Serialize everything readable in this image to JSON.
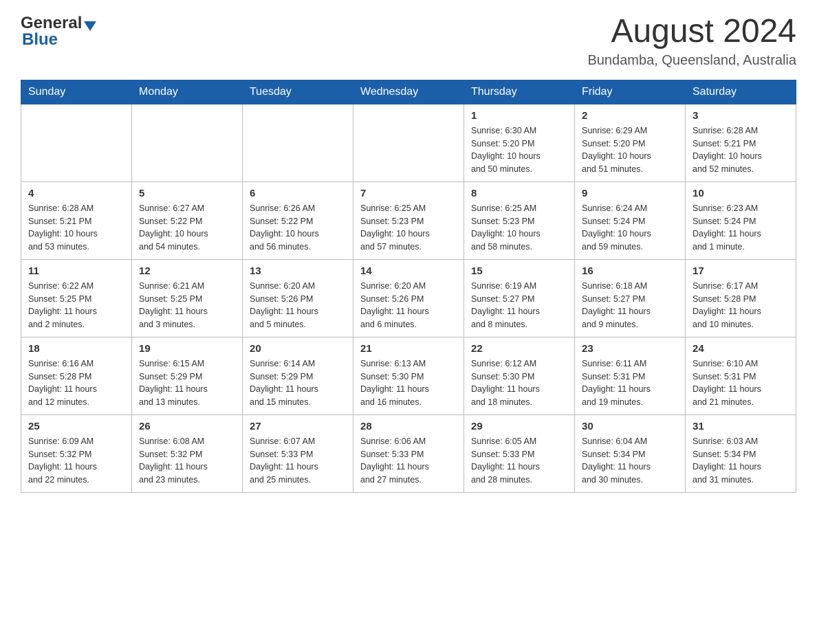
{
  "header": {
    "logo_general": "General",
    "logo_blue": "Blue",
    "month_title": "August 2024",
    "location": "Bundamba, Queensland, Australia"
  },
  "calendar": {
    "days_of_week": [
      "Sunday",
      "Monday",
      "Tuesday",
      "Wednesday",
      "Thursday",
      "Friday",
      "Saturday"
    ],
    "weeks": [
      [
        {
          "day": "",
          "info": ""
        },
        {
          "day": "",
          "info": ""
        },
        {
          "day": "",
          "info": ""
        },
        {
          "day": "",
          "info": ""
        },
        {
          "day": "1",
          "info": "Sunrise: 6:30 AM\nSunset: 5:20 PM\nDaylight: 10 hours\nand 50 minutes."
        },
        {
          "day": "2",
          "info": "Sunrise: 6:29 AM\nSunset: 5:20 PM\nDaylight: 10 hours\nand 51 minutes."
        },
        {
          "day": "3",
          "info": "Sunrise: 6:28 AM\nSunset: 5:21 PM\nDaylight: 10 hours\nand 52 minutes."
        }
      ],
      [
        {
          "day": "4",
          "info": "Sunrise: 6:28 AM\nSunset: 5:21 PM\nDaylight: 10 hours\nand 53 minutes."
        },
        {
          "day": "5",
          "info": "Sunrise: 6:27 AM\nSunset: 5:22 PM\nDaylight: 10 hours\nand 54 minutes."
        },
        {
          "day": "6",
          "info": "Sunrise: 6:26 AM\nSunset: 5:22 PM\nDaylight: 10 hours\nand 56 minutes."
        },
        {
          "day": "7",
          "info": "Sunrise: 6:25 AM\nSunset: 5:23 PM\nDaylight: 10 hours\nand 57 minutes."
        },
        {
          "day": "8",
          "info": "Sunrise: 6:25 AM\nSunset: 5:23 PM\nDaylight: 10 hours\nand 58 minutes."
        },
        {
          "day": "9",
          "info": "Sunrise: 6:24 AM\nSunset: 5:24 PM\nDaylight: 10 hours\nand 59 minutes."
        },
        {
          "day": "10",
          "info": "Sunrise: 6:23 AM\nSunset: 5:24 PM\nDaylight: 11 hours\nand 1 minute."
        }
      ],
      [
        {
          "day": "11",
          "info": "Sunrise: 6:22 AM\nSunset: 5:25 PM\nDaylight: 11 hours\nand 2 minutes."
        },
        {
          "day": "12",
          "info": "Sunrise: 6:21 AM\nSunset: 5:25 PM\nDaylight: 11 hours\nand 3 minutes."
        },
        {
          "day": "13",
          "info": "Sunrise: 6:20 AM\nSunset: 5:26 PM\nDaylight: 11 hours\nand 5 minutes."
        },
        {
          "day": "14",
          "info": "Sunrise: 6:20 AM\nSunset: 5:26 PM\nDaylight: 11 hours\nand 6 minutes."
        },
        {
          "day": "15",
          "info": "Sunrise: 6:19 AM\nSunset: 5:27 PM\nDaylight: 11 hours\nand 8 minutes."
        },
        {
          "day": "16",
          "info": "Sunrise: 6:18 AM\nSunset: 5:27 PM\nDaylight: 11 hours\nand 9 minutes."
        },
        {
          "day": "17",
          "info": "Sunrise: 6:17 AM\nSunset: 5:28 PM\nDaylight: 11 hours\nand 10 minutes."
        }
      ],
      [
        {
          "day": "18",
          "info": "Sunrise: 6:16 AM\nSunset: 5:28 PM\nDaylight: 11 hours\nand 12 minutes."
        },
        {
          "day": "19",
          "info": "Sunrise: 6:15 AM\nSunset: 5:29 PM\nDaylight: 11 hours\nand 13 minutes."
        },
        {
          "day": "20",
          "info": "Sunrise: 6:14 AM\nSunset: 5:29 PM\nDaylight: 11 hours\nand 15 minutes."
        },
        {
          "day": "21",
          "info": "Sunrise: 6:13 AM\nSunset: 5:30 PM\nDaylight: 11 hours\nand 16 minutes."
        },
        {
          "day": "22",
          "info": "Sunrise: 6:12 AM\nSunset: 5:30 PM\nDaylight: 11 hours\nand 18 minutes."
        },
        {
          "day": "23",
          "info": "Sunrise: 6:11 AM\nSunset: 5:31 PM\nDaylight: 11 hours\nand 19 minutes."
        },
        {
          "day": "24",
          "info": "Sunrise: 6:10 AM\nSunset: 5:31 PM\nDaylight: 11 hours\nand 21 minutes."
        }
      ],
      [
        {
          "day": "25",
          "info": "Sunrise: 6:09 AM\nSunset: 5:32 PM\nDaylight: 11 hours\nand 22 minutes."
        },
        {
          "day": "26",
          "info": "Sunrise: 6:08 AM\nSunset: 5:32 PM\nDaylight: 11 hours\nand 23 minutes."
        },
        {
          "day": "27",
          "info": "Sunrise: 6:07 AM\nSunset: 5:33 PM\nDaylight: 11 hours\nand 25 minutes."
        },
        {
          "day": "28",
          "info": "Sunrise: 6:06 AM\nSunset: 5:33 PM\nDaylight: 11 hours\nand 27 minutes."
        },
        {
          "day": "29",
          "info": "Sunrise: 6:05 AM\nSunset: 5:33 PM\nDaylight: 11 hours\nand 28 minutes."
        },
        {
          "day": "30",
          "info": "Sunrise: 6:04 AM\nSunset: 5:34 PM\nDaylight: 11 hours\nand 30 minutes."
        },
        {
          "day": "31",
          "info": "Sunrise: 6:03 AM\nSunset: 5:34 PM\nDaylight: 11 hours\nand 31 minutes."
        }
      ]
    ]
  }
}
